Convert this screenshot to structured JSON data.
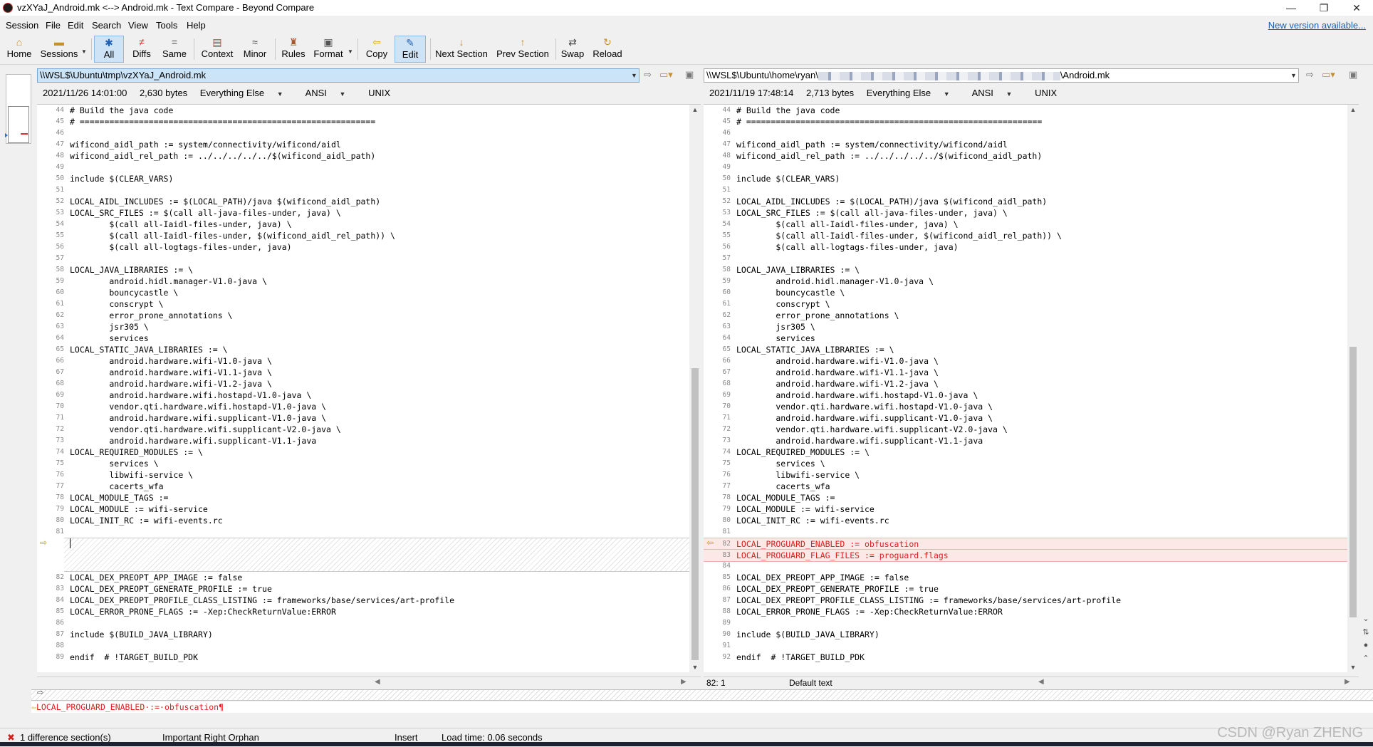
{
  "window": {
    "title": "vzXYaJ_Android.mk <--> Android.mk - Text Compare - Beyond Compare",
    "minimize": "—",
    "restore": "❐",
    "close": "✕"
  },
  "menu": {
    "items": [
      "Session",
      "File",
      "Edit",
      "Search",
      "View",
      "Tools",
      "Help"
    ],
    "new_version_link": "New version available..."
  },
  "toolbar": {
    "buttons": [
      {
        "label": "Home",
        "icon": "home-icon"
      },
      {
        "label": "Sessions",
        "icon": "sessions-icon"
      },
      {
        "label": "All",
        "icon": "all-icon"
      },
      {
        "label": "Diffs",
        "icon": "diffs-icon"
      },
      {
        "label": "Same",
        "icon": "same-icon"
      },
      {
        "label": "Context",
        "icon": "context-icon"
      },
      {
        "label": "Minor",
        "icon": "minor-icon"
      },
      {
        "label": "Rules",
        "icon": "rules-icon"
      },
      {
        "label": "Format",
        "icon": "format-icon"
      },
      {
        "label": "Copy",
        "icon": "copy-icon"
      },
      {
        "label": "Edit",
        "icon": "edit-icon"
      },
      {
        "label": "Next Section",
        "icon": "next-section-icon"
      },
      {
        "label": "Prev Section",
        "icon": "prev-section-icon"
      },
      {
        "label": "Swap",
        "icon": "swap-icon"
      },
      {
        "label": "Reload",
        "icon": "reload-icon"
      }
    ],
    "active": [
      "All",
      "Edit"
    ]
  },
  "left": {
    "path": "\\\\WSL$\\Ubuntu\\tmp\\vzXYaJ_Android.mk",
    "date": "2021/11/26 14:01:00",
    "size": "2,630 bytes",
    "format": "Everything Else",
    "encoding": "ANSI",
    "line_endings": "UNIX"
  },
  "right": {
    "path_prefix": "\\\\WSL$\\Ubuntu\\home\\ryan\\",
    "path_suffix": "\\Android.mk",
    "date": "2021/11/19 17:48:14",
    "size": "2,713 bytes",
    "format": "Everything Else",
    "encoding": "ANSI",
    "line_endings": "UNIX"
  },
  "left_lines": [
    {
      "n": "44",
      "t": "# Build the java code"
    },
    {
      "n": "45",
      "t": "# ============================================================"
    },
    {
      "n": "46",
      "t": ""
    },
    {
      "n": "47",
      "t": "wificond_aidl_path := system/connectivity/wificond/aidl"
    },
    {
      "n": "48",
      "t": "wificond_aidl_rel_path := ../../../../../$(wificond_aidl_path)"
    },
    {
      "n": "49",
      "t": ""
    },
    {
      "n": "50",
      "t": "include $(CLEAR_VARS)"
    },
    {
      "n": "51",
      "t": ""
    },
    {
      "n": "52",
      "t": "LOCAL_AIDL_INCLUDES := $(LOCAL_PATH)/java $(wificond_aidl_path)"
    },
    {
      "n": "53",
      "t": "LOCAL_SRC_FILES := $(call all-java-files-under, java) \\"
    },
    {
      "n": "54",
      "t": "        $(call all-Iaidl-files-under, java) \\"
    },
    {
      "n": "55",
      "t": "        $(call all-Iaidl-files-under, $(wificond_aidl_rel_path)) \\"
    },
    {
      "n": "56",
      "t": "        $(call all-logtags-files-under, java)"
    },
    {
      "n": "57",
      "t": ""
    },
    {
      "n": "58",
      "t": "LOCAL_JAVA_LIBRARIES := \\"
    },
    {
      "n": "59",
      "t": "        android.hidl.manager-V1.0-java \\"
    },
    {
      "n": "60",
      "t": "        bouncycastle \\"
    },
    {
      "n": "61",
      "t": "        conscrypt \\"
    },
    {
      "n": "62",
      "t": "        error_prone_annotations \\"
    },
    {
      "n": "63",
      "t": "        jsr305 \\"
    },
    {
      "n": "64",
      "t": "        services"
    },
    {
      "n": "65",
      "t": "LOCAL_STATIC_JAVA_LIBRARIES := \\"
    },
    {
      "n": "66",
      "t": "        android.hardware.wifi-V1.0-java \\"
    },
    {
      "n": "67",
      "t": "        android.hardware.wifi-V1.1-java \\"
    },
    {
      "n": "68",
      "t": "        android.hardware.wifi-V1.2-java \\"
    },
    {
      "n": "69",
      "t": "        android.hardware.wifi.hostapd-V1.0-java \\"
    },
    {
      "n": "70",
      "t": "        vendor.qti.hardware.wifi.hostapd-V1.0-java \\"
    },
    {
      "n": "71",
      "t": "        android.hardware.wifi.supplicant-V1.0-java \\"
    },
    {
      "n": "72",
      "t": "        vendor.qti.hardware.wifi.supplicant-V2.0-java \\"
    },
    {
      "n": "73",
      "t": "        android.hardware.wifi.supplicant-V1.1-java"
    },
    {
      "n": "74",
      "t": "LOCAL_REQUIRED_MODULES := \\"
    },
    {
      "n": "75",
      "t": "        services \\"
    },
    {
      "n": "76",
      "t": "        libwifi-service \\"
    },
    {
      "n": "77",
      "t": "        cacerts_wfa"
    },
    {
      "n": "78",
      "t": "LOCAL_MODULE_TAGS :="
    },
    {
      "n": "79",
      "t": "LOCAL_MODULE := wifi-service"
    },
    {
      "n": "80",
      "t": "LOCAL_INIT_RC := wifi-events.rc"
    },
    {
      "n": "81",
      "t": ""
    }
  ],
  "left_lines_after": [
    {
      "n": "82",
      "t": "LOCAL_DEX_PREOPT_APP_IMAGE := false"
    },
    {
      "n": "83",
      "t": "LOCAL_DEX_PREOPT_GENERATE_PROFILE := true"
    },
    {
      "n": "84",
      "t": "LOCAL_DEX_PREOPT_PROFILE_CLASS_LISTING := frameworks/base/services/art-profile"
    },
    {
      "n": "85",
      "t": "LOCAL_ERROR_PRONE_FLAGS := -Xep:CheckReturnValue:ERROR"
    },
    {
      "n": "86",
      "t": ""
    },
    {
      "n": "87",
      "t": "include $(BUILD_JAVA_LIBRARY)"
    },
    {
      "n": "88",
      "t": ""
    },
    {
      "n": "89",
      "t": "endif  # !TARGET_BUILD_PDK"
    }
  ],
  "right_lines": [
    {
      "n": "44",
      "t": "# Build the java code"
    },
    {
      "n": "45",
      "t": "# ============================================================"
    },
    {
      "n": "46",
      "t": ""
    },
    {
      "n": "47",
      "t": "wificond_aidl_path := system/connectivity/wificond/aidl"
    },
    {
      "n": "48",
      "t": "wificond_aidl_rel_path := ../../../../../$(wificond_aidl_path)"
    },
    {
      "n": "49",
      "t": ""
    },
    {
      "n": "50",
      "t": "include $(CLEAR_VARS)"
    },
    {
      "n": "51",
      "t": ""
    },
    {
      "n": "52",
      "t": "LOCAL_AIDL_INCLUDES := $(LOCAL_PATH)/java $(wificond_aidl_path)"
    },
    {
      "n": "53",
      "t": "LOCAL_SRC_FILES := $(call all-java-files-under, java) \\"
    },
    {
      "n": "54",
      "t": "        $(call all-Iaidl-files-under, java) \\"
    },
    {
      "n": "55",
      "t": "        $(call all-Iaidl-files-under, $(wificond_aidl_rel_path)) \\"
    },
    {
      "n": "56",
      "t": "        $(call all-logtags-files-under, java)"
    },
    {
      "n": "57",
      "t": ""
    },
    {
      "n": "58",
      "t": "LOCAL_JAVA_LIBRARIES := \\"
    },
    {
      "n": "59",
      "t": "        android.hidl.manager-V1.0-java \\"
    },
    {
      "n": "60",
      "t": "        bouncycastle \\"
    },
    {
      "n": "61",
      "t": "        conscrypt \\"
    },
    {
      "n": "62",
      "t": "        error_prone_annotations \\"
    },
    {
      "n": "63",
      "t": "        jsr305 \\"
    },
    {
      "n": "64",
      "t": "        services"
    },
    {
      "n": "65",
      "t": "LOCAL_STATIC_JAVA_LIBRARIES := \\"
    },
    {
      "n": "66",
      "t": "        android.hardware.wifi-V1.0-java \\"
    },
    {
      "n": "67",
      "t": "        android.hardware.wifi-V1.1-java \\"
    },
    {
      "n": "68",
      "t": "        android.hardware.wifi-V1.2-java \\"
    },
    {
      "n": "69",
      "t": "        android.hardware.wifi.hostapd-V1.0-java \\"
    },
    {
      "n": "70",
      "t": "        vendor.qti.hardware.wifi.hostapd-V1.0-java \\"
    },
    {
      "n": "71",
      "t": "        android.hardware.wifi.supplicant-V1.0-java \\"
    },
    {
      "n": "72",
      "t": "        vendor.qti.hardware.wifi.supplicant-V2.0-java \\"
    },
    {
      "n": "73",
      "t": "        android.hardware.wifi.supplicant-V1.1-java"
    },
    {
      "n": "74",
      "t": "LOCAL_REQUIRED_MODULES := \\"
    },
    {
      "n": "75",
      "t": "        services \\"
    },
    {
      "n": "76",
      "t": "        libwifi-service \\"
    },
    {
      "n": "77",
      "t": "        cacerts_wfa"
    },
    {
      "n": "78",
      "t": "LOCAL_MODULE_TAGS :="
    },
    {
      "n": "79",
      "t": "LOCAL_MODULE := wifi-service"
    },
    {
      "n": "80",
      "t": "LOCAL_INIT_RC := wifi-events.rc"
    },
    {
      "n": "81",
      "t": ""
    },
    {
      "n": "82",
      "t": "LOCAL_PROGUARD_ENABLED := obfuscation",
      "diff": true
    },
    {
      "n": "83",
      "t": "LOCAL_PROGUARD_FLAG_FILES := proguard.flags",
      "diff": true
    },
    {
      "n": "84",
      "t": ""
    },
    {
      "n": "85",
      "t": "LOCAL_DEX_PREOPT_APP_IMAGE := false"
    },
    {
      "n": "86",
      "t": "LOCAL_DEX_PREOPT_GENERATE_PROFILE := true"
    },
    {
      "n": "87",
      "t": "LOCAL_DEX_PREOPT_PROFILE_CLASS_LISTING := frameworks/base/services/art-profile"
    },
    {
      "n": "88",
      "t": "LOCAL_ERROR_PRONE_FLAGS := -Xep:CheckReturnValue:ERROR"
    },
    {
      "n": "89",
      "t": ""
    },
    {
      "n": "90",
      "t": "include $(BUILD_JAVA_LIBRARY)"
    },
    {
      "n": "91",
      "t": ""
    },
    {
      "n": "92",
      "t": "endif  # !TARGET_BUILD_PDK"
    }
  ],
  "pane_status": {
    "position": "82: 1",
    "text_kind": "Default text"
  },
  "current_line": "LOCAL_PROGUARD_ENABLED·:=·obfuscation¶",
  "status": {
    "differences": "1 difference section(s)",
    "importance": "Important Right Orphan",
    "mode": "Insert",
    "load_time": "Load time: 0.06 seconds"
  },
  "watermark": "CSDN @Ryan ZHENG",
  "colors": {
    "diff_text": "#e02020",
    "diff_bg": "#fde8e8",
    "link": "#1a5fb4",
    "active_button": "#cfe3f7"
  }
}
